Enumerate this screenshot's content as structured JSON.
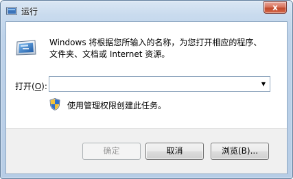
{
  "window": {
    "title": "运行",
    "close_glyph": "x"
  },
  "description": {
    "line1": "Windows 将根据您所输入的名称，为您打开相应的程序、",
    "line2": "文件夹、文档或 Internet 资源。"
  },
  "open": {
    "label_prefix": "打开(",
    "label_hotkey": "O",
    "label_suffix": "):",
    "value": ""
  },
  "admin_note": "使用管理权限创建此任务。",
  "buttons": {
    "ok": "确定",
    "cancel": "取消",
    "browse": "浏览(B)..."
  },
  "icons": {
    "title": "run-icon",
    "main": "run-program-icon",
    "dropdown": "chevron-down-icon",
    "admin": "uac-shield-icon"
  },
  "colors": {
    "title_bar": "#bed3ea",
    "close_button": "#c24a2d",
    "client_bg": "#ffffff",
    "footer_bg": "#f0f0f0"
  }
}
